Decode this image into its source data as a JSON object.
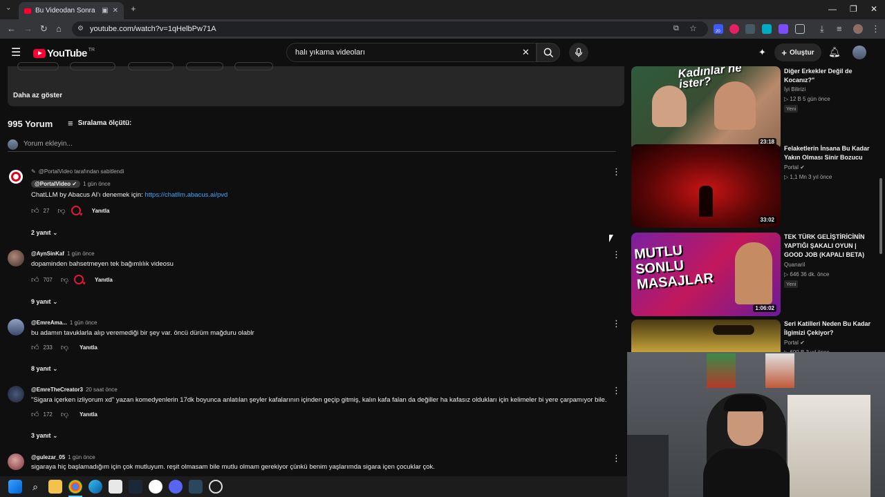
{
  "browser": {
    "tab_title": "Bu Videodan Sonra Sigaray",
    "url": "youtube.com/watch?v=1qHelbPw71A",
    "win_min": "—",
    "win_max": "❐",
    "win_close": "✕",
    "ext_badge": "20"
  },
  "youtube": {
    "logo": "YouTube",
    "region": "TR",
    "search_value": "halı yıkama videoları",
    "create_label": "Oluştur"
  },
  "description": {
    "show_less": "Daha az göster"
  },
  "comments_header": {
    "count": "995 Yorum",
    "sort_label": "Sıralama ölçütü:",
    "add_placeholder": "Yorum ekleyin..."
  },
  "comments": [
    {
      "pinned_by": "@PortalVideo tarafından sabitlendi",
      "author": "@PortalVideo",
      "time": "1 gün önce",
      "text_prefix": "ChatLLM by Abacus AI'ı denemek için:",
      "link": "https://chatllm.abacus.ai/pvd",
      "likes": "27",
      "reply_label": "Yanıtla",
      "replies": "2 yanıt"
    },
    {
      "author": "@AynSinKaf",
      "time": "1 gün önce",
      "text": "dopaminden bahsetmeyen tek bağımlılık videosu",
      "likes": "707",
      "reply_label": "Yanıtla",
      "replies": "9 yanıt"
    },
    {
      "author": "@EmreAma...",
      "time": "1 gün önce",
      "text": "bu adamın tavuklarla alıp veremediği bir şey var. öncü dürüm mağduru olablr",
      "likes": "233",
      "reply_label": "Yanıtla",
      "replies": "8 yanıt"
    },
    {
      "author": "@EmreTheCreator3",
      "time": "20 saat önce",
      "text": "\"Sigara içerken izliyorum xd\" yazan komedyenlerin 17dk boyunca anlatılan şeyler kafalarının içinden geçip gitmiş, kalın kafa falan da değiller ha kafasız oldukları için kelimeler bi yere çarpamıyor bile.",
      "likes": "172",
      "reply_label": "Yanıtla",
      "replies": "3 yanıt"
    },
    {
      "author": "@gulezar_05",
      "time": "1 gün önce",
      "text": "sigaraya hiç başlamadığım için çok mutluyum. reşit olmasam bile mutlu olmam gerekiyor çünkü benim yaşlarımda sigara içen çocuklar çok."
    }
  ],
  "sidebar": [
    {
      "thumb_text": "Kadınlar ne ister?",
      "duration": "23:18",
      "title": "Diğer Erkekler Değil de Kocanız?\"",
      "channel": "İyi Bilirizi",
      "stats": "▷ 12 B   5 gün önce",
      "badge": "Yeni"
    },
    {
      "duration": "33:02",
      "title": "Felaketlerin İnsana Bu Kadar Yakın Olması Sinir Bozucu",
      "channel": "Portal",
      "stats": "▷ 1,1 Mn   3 yıl önce"
    },
    {
      "thumb_text": "MUTLU SONLU MASAJLAR",
      "duration": "1:06:02",
      "title": "TEK TÜRK GELİŞTİRİCİNİN YAPTIĞI ŞAKALI OYUN | GOOD JOB (KAPALI BETA)",
      "channel": "Quanaril",
      "stats": "▷ 646   36 dk. önce",
      "badge": "Yeni"
    },
    {
      "title": "Seri Katilleri Neden Bu Kadar İlgimizi Çekiyor?",
      "channel": "Portal",
      "stats": "▷ 600 B   3 yıl önce"
    }
  ],
  "colors": {
    "yt_red": "#ff0033",
    "bg": "#0f0f0f",
    "link": "#3ea6ff",
    "heart": "#e3163a"
  }
}
